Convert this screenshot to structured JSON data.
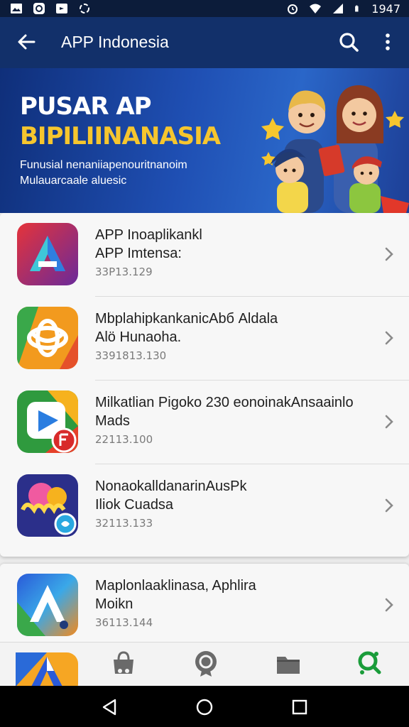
{
  "status_bar": {
    "time": "1947",
    "left_icons": [
      "image-icon",
      "app-notification-icon",
      "message-icon",
      "sync-icon"
    ],
    "right_icons": [
      "alarm-icon",
      "wifi-icon",
      "signal-icon",
      "battery-icon"
    ]
  },
  "app_bar": {
    "title": "APP Indonesia",
    "back_icon": "arrow-back-icon",
    "search_icon": "search-icon",
    "more_icon": "more-vert-icon",
    "color": "#12306a"
  },
  "banner": {
    "title_line1": "PUSAR AP",
    "title_line2": "BIPILIINANASIA",
    "subtitle_line1": "Funusial nenaniiapenouritnanoim",
    "subtitle_line2": "Mulauarcaale aluesic",
    "title_color": "#ffffff",
    "accent_color": "#f6c62e"
  },
  "apps": [
    {
      "name_line1": "APP Inoaplikankl",
      "name_line2": "APP Imtensa:",
      "meta": "33P13.129",
      "icon": "app-a-logo-icon"
    },
    {
      "name_line1": "MbplahipkankanicАbб Aldala",
      "name_line2": "Alö Hunaoha.",
      "meta": "3391813.130",
      "icon": "app-knot-logo-icon"
    },
    {
      "name_line1": "Milkatlian Pigoko 230 еonoinakАnsaainlo",
      "name_line2": "Mads",
      "meta": "22113.100",
      "icon": "app-play-logo-icon"
    },
    {
      "name_line1": "NonaokalldanarinАusPk",
      "name_line2": "Iliok Cuadsa",
      "meta": "32113.133",
      "icon": "app-awra-logo-icon"
    },
    {
      "name_line1": "Maplonlaaklinasa, Aphlira",
      "name_line2": "Moikn",
      "meta": "36113.144",
      "icon": "app-a-blue-logo-icon"
    }
  ],
  "tab_bar": {
    "tabs": [
      "home-app-icon",
      "store-bag-icon",
      "badge-icon",
      "folder-icon",
      "explore-icon"
    ],
    "active_color": "#1a9c3a"
  },
  "nav_bar": {
    "buttons": [
      "nav-back-icon",
      "nav-home-icon",
      "nav-recents-icon"
    ]
  }
}
